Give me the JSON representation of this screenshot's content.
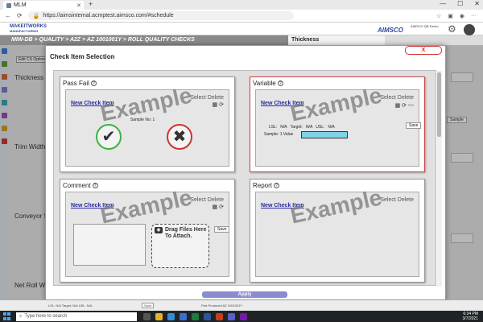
{
  "browser": {
    "tab_title": "MLM",
    "tab_close": "✕",
    "new_tab": "+",
    "url": "https://aimsinternal.acmptest.aimsco.com/#schedule",
    "window_controls": [
      "—",
      "☐",
      "✕"
    ]
  },
  "app": {
    "logo_line1": "MAKEITWORKS",
    "logo_line2": "MANUFACTURING",
    "brand": "AIMSCO",
    "demo_label": "AIMSCO QB Demo",
    "breadcrumb": "MIW-DB > QUALITY > A2Z > AZ 1001001Y > ROLL QUALITY CHECKS",
    "right_heading": "Thickness",
    "edit_button": "Edit CS Options",
    "bg_rows": [
      "Thickness",
      "Trim Width",
      "Conveyor S",
      "Net Roll W"
    ],
    "bg_card_label": "Sample",
    "sample_select": "Sample",
    "bottom_left": "LSL: N/A  Target: N/A  USL: N/A",
    "bottom_save": "Save",
    "bottom_part": "Part Produced    AZ 1001001Y"
  },
  "modal": {
    "title": "Check Item Selection",
    "close_label": "X",
    "apply_label": "Apply",
    "watermark": "Example",
    "new_check_item": "New Check Item",
    "select_label": "Select",
    "delete_label": "Delete",
    "panels": {
      "pass_fail": {
        "title": "Pass Fail",
        "sample_no": "Sample No: 1"
      },
      "variable": {
        "title": "Variable",
        "lsl": "LSL:",
        "lsl_value": "N/A",
        "target": "Target:",
        "target_value": "N/A",
        "usl": "USL:",
        "usl_value": "N/A",
        "sample_value_label": "Sample: 1 Value",
        "save": "Save"
      },
      "comment": {
        "title": "Comment",
        "drag_text": "Drag Files Here To Attach.",
        "save": "Save"
      },
      "report": {
        "title": "Report"
      }
    }
  },
  "taskbar": {
    "search_placeholder": "Type here to search",
    "time": "6:34 PM",
    "date": "3/7/2021"
  },
  "colors": {
    "brand_blue": "#2f4aa0",
    "pass_green": "#3db33d",
    "fail_red": "#cc3333",
    "apply_purple": "#8a8cd0",
    "value_cyan": "#7fd3e6"
  }
}
